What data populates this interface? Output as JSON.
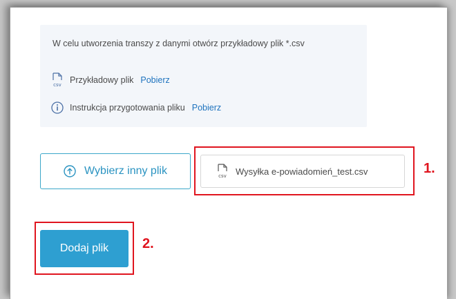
{
  "info": {
    "description": "W celu utworzenia transzy z danymi otwórz przykładowy plik *.csv",
    "sample_label": "Przykładowy plik",
    "sample_link": "Pobierz",
    "instructions_label": "Instrukcja przygotowania pliku",
    "instructions_link": "Pobierz"
  },
  "upload": {
    "choose_label": "Wybierz inny plik",
    "file_name": "Wysyłka e-powiadomień_test.csv",
    "add_label": "Dodaj plik"
  },
  "annotations": {
    "marker_1": "1.",
    "marker_2": "2.",
    "highlight_color": "#e0141e"
  },
  "icons": {
    "file": "csv-file-icon",
    "info": "info-circle-icon",
    "upload": "upload-arrow-icon"
  },
  "colors": {
    "accent": "#2e9fd1",
    "link": "#1e73be",
    "info_bg": "#f3f6fa"
  }
}
